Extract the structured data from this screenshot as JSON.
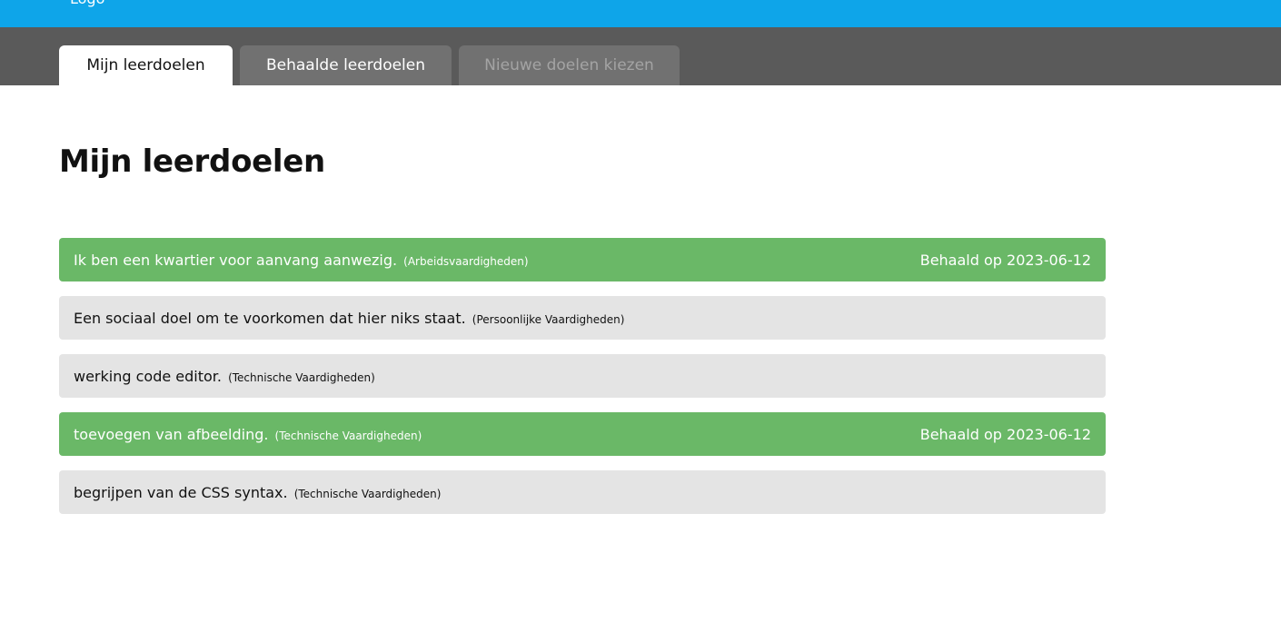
{
  "header": {
    "logo": "Logo"
  },
  "tabs": [
    {
      "label": "Mijn leerdoelen",
      "state": "active"
    },
    {
      "label": "Behaalde leerdoelen",
      "state": "normal"
    },
    {
      "label": "Nieuwe doelen kiezen",
      "state": "disabled"
    }
  ],
  "main": {
    "title": "Mijn leerdoelen"
  },
  "goals": [
    {
      "text": "Ik ben een kwartier voor aanvang aanwezig.",
      "category": "(Arbeidsvaardigheden)",
      "status": "Behaald op 2023-06-12"
    },
    {
      "text": "Een sociaal doel om te voorkomen dat hier niks staat.",
      "category": "(Persoonlijke Vaardigheden)",
      "status": ""
    },
    {
      "text": "werking code editor.",
      "category": "(Technische Vaardigheden)",
      "status": ""
    },
    {
      "text": "toevoegen van afbeelding.",
      "category": "(Technische Vaardigheden)",
      "status": "Behaald op 2023-06-12"
    },
    {
      "text": "begrijpen van de CSS syntax.",
      "category": "(Technische Vaardigheden)",
      "status": ""
    }
  ],
  "colors": {
    "topbar": "#0ea5e9",
    "tabbar": "#5a5a5a",
    "tab_inactive": "#717171",
    "achieved": "#6ab867",
    "open": "#e4e4e4"
  }
}
